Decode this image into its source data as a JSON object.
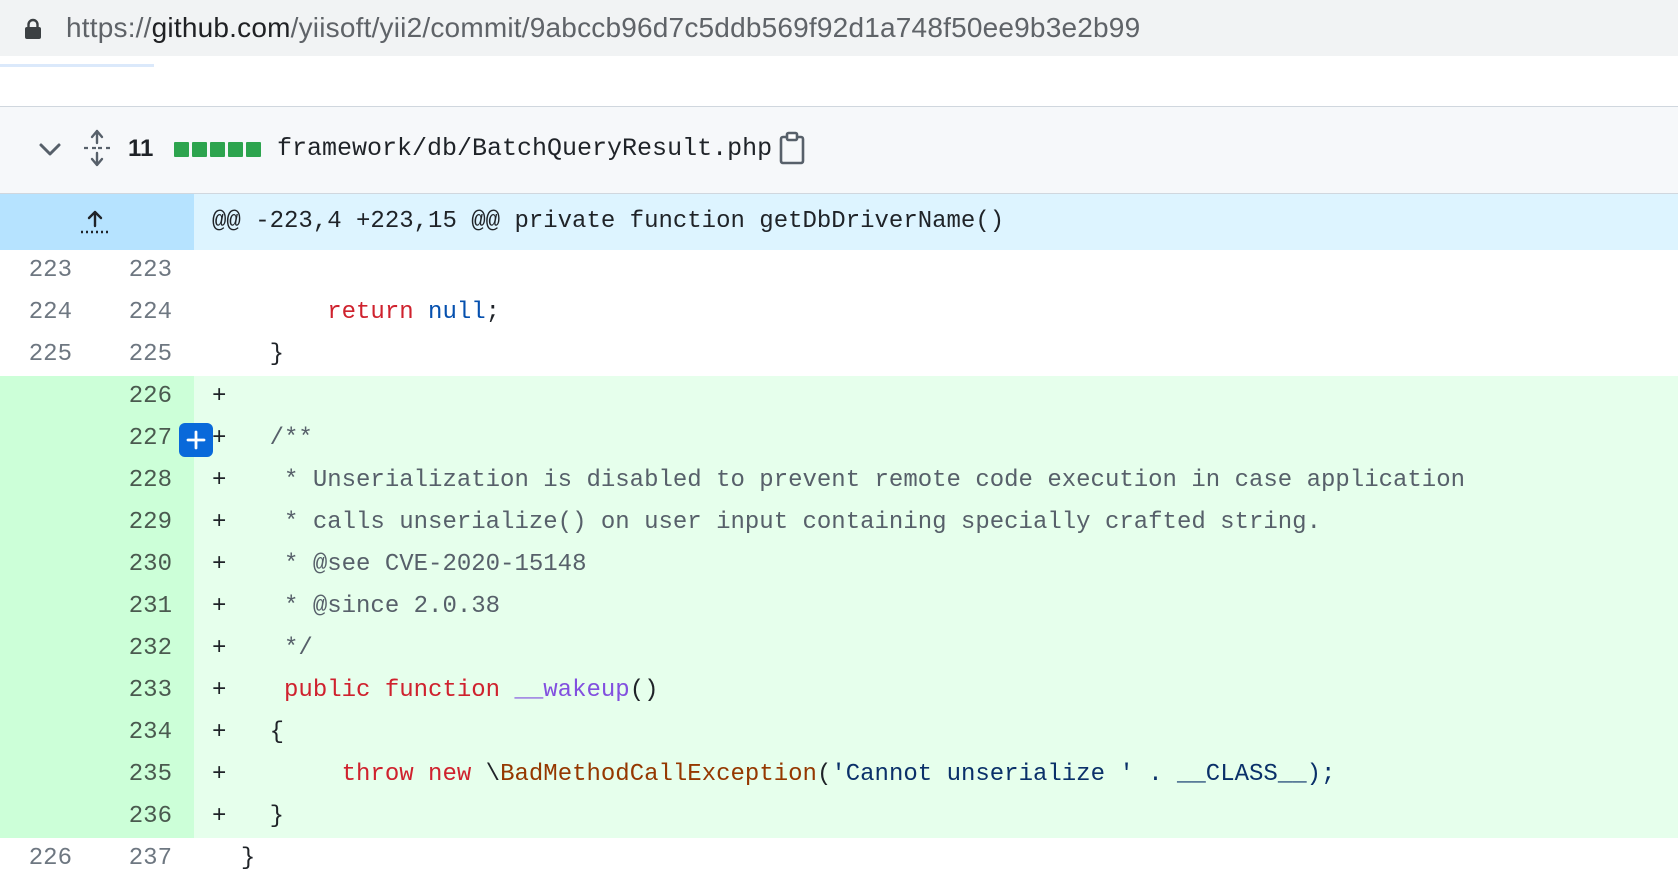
{
  "browser": {
    "url_prefix": "https://",
    "url_host": "github.com",
    "url_path": "/yiisoft/yii2/commit/9abccb96d7c5ddb569f92d1a748f50ee9b3e2b99"
  },
  "file": {
    "change_count": "11",
    "path": "framework/db/BatchQueryResult.php",
    "diffstat_blocks": 5,
    "diffstat_color": "#2da44e"
  },
  "hunk": {
    "header": "@@ -223,4 +223,15 @@ private function getDbDriverName()"
  },
  "lines": [
    {
      "old": "223",
      "new": "223",
      "sign": "",
      "text": ""
    },
    {
      "old": "224",
      "new": "224",
      "sign": "",
      "text": "        return null;"
    },
    {
      "old": "225",
      "new": "225",
      "sign": "",
      "text": "    }"
    },
    {
      "old": "",
      "new": "226",
      "sign": "+",
      "text": ""
    },
    {
      "old": "",
      "new": "227",
      "sign": "+",
      "text": "    /**"
    },
    {
      "old": "",
      "new": "228",
      "sign": "+",
      "text": "     * Unserialization is disabled to prevent remote code execution in case application"
    },
    {
      "old": "",
      "new": "229",
      "sign": "+",
      "text": "     * calls unserialize() on user input containing specially crafted string."
    },
    {
      "old": "",
      "new": "230",
      "sign": "+",
      "text": "     * @see CVE-2020-15148"
    },
    {
      "old": "",
      "new": "231",
      "sign": "+",
      "text": "     * @since 2.0.38"
    },
    {
      "old": "",
      "new": "232",
      "sign": "+",
      "text": "     */"
    },
    {
      "old": "",
      "new": "233",
      "sign": "+",
      "text": "    public function __wakeup()"
    },
    {
      "old": "",
      "new": "234",
      "sign": "+",
      "text": "    {"
    },
    {
      "old": "",
      "new": "235",
      "sign": "+",
      "text": "        throw new \\BadMethodCallException('Cannot unserialize ' . __CLASS__);"
    },
    {
      "old": "",
      "new": "236",
      "sign": "+",
      "text": "    }"
    },
    {
      "old": "226",
      "new": "237",
      "sign": "",
      "text": "}"
    }
  ],
  "tokens": {
    "return": "return",
    "null": "null",
    "semi": ";",
    "public": "public",
    "function": "function",
    "wakeup": "__wakeup",
    "parens": "()",
    "throw": "throw",
    "new": "new",
    "backslash": "\\",
    "exception": "BadMethodCallException",
    "open": "(",
    "string": "'Cannot unserialize '",
    "concat": " . __CLASS__);"
  },
  "colors": {
    "add_bg": "#e6ffec",
    "add_gutter": "#ccffd8",
    "hunk_bg": "#ddf4ff",
    "keyword": "#cf222e",
    "constant": "#0550ae",
    "function_name": "#8250df",
    "class_name": "#953800"
  }
}
